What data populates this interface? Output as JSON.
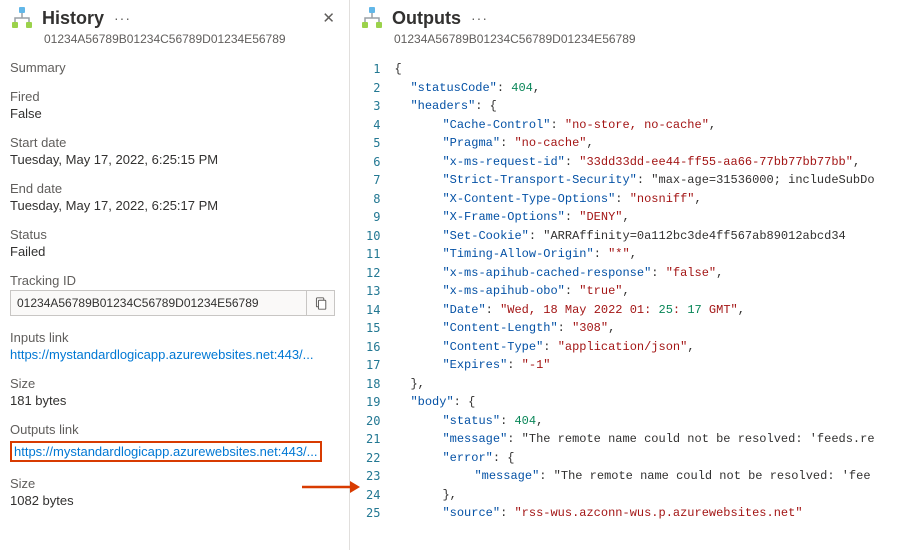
{
  "history": {
    "title": "History",
    "sub": "01234A56789B01234C56789D01234E56789",
    "summary_label": "Summary",
    "fired_label": "Fired",
    "fired_value": "False",
    "start_label": "Start date",
    "start_value": "Tuesday, May 17, 2022, 6:25:15 PM",
    "end_label": "End date",
    "end_value": "Tuesday, May 17, 2022, 6:25:17 PM",
    "status_label": "Status",
    "status_value": "Failed",
    "tracking_label": "Tracking ID",
    "tracking_value": "01234A56789B01234C56789D01234E56789",
    "inputs_link_label": "Inputs link",
    "inputs_link": "https://mystandardlogicapp.azurewebsites.net:443/...",
    "inputs_size_label": "Size",
    "inputs_size_value": "181 bytes",
    "outputs_link_label": "Outputs link",
    "outputs_link": "https://mystandardlogicapp.azurewebsites.net:443/...",
    "outputs_size_label": "Size",
    "outputs_size_value": "1082 bytes"
  },
  "outputs": {
    "title": "Outputs",
    "sub": "01234A56789B01234C56789D01234E56789"
  },
  "chart_data": {
    "type": "table",
    "note": "JSON response payload shown in Outputs code pane",
    "statusCode": 404,
    "headers": {
      "Cache-Control": "no-store, no-cache",
      "Pragma": "no-cache",
      "x-ms-request-id": "33dd33dd-ee44-ff55-aa66-77bb77bb77bb",
      "Strict-Transport-Security": "max-age=31536000; includeSubDo",
      "X-Content-Type-Options": "nosniff",
      "X-Frame-Options": "DENY",
      "Set-Cookie": "ARRAffinity=0a112bc3de4ff567ab89012abcd34",
      "Timing-Allow-Origin": "*",
      "x-ms-apihub-cached-response": "false",
      "x-ms-apihub-obo": "true",
      "Date": "Wed, 18 May 2022 01:25:17 GMT",
      "Content-Length": "308",
      "Content-Type": "application/json",
      "Expires": "-1"
    },
    "body": {
      "status": 404,
      "message": "The remote name could not be resolved: 'feeds.re",
      "error": {
        "message": "The remote name could not be resolved: 'fee"
      },
      "source": "rss-wus.azconn-wus.p.azurewebsites.net"
    }
  },
  "code_lines": [
    "{",
    "  \"statusCode\": 404,",
    "  \"headers\": {",
    "    \"Cache-Control\": \"no-store, no-cache\",",
    "    \"Pragma\": \"no-cache\",",
    "    \"x-ms-request-id\": \"33dd33dd-ee44-ff55-aa66-77bb77bb77bb\",",
    "    \"Strict-Transport-Security\": \"max-age=31536000; includeSubDo",
    "    \"X-Content-Type-Options\": \"nosniff\",",
    "    \"X-Frame-Options\": \"DENY\",",
    "    \"Set-Cookie\": \"ARRAffinity=0a112bc3de4ff567ab89012abcd34",
    "    \"Timing-Allow-Origin\": \"*\",",
    "    \"x-ms-apihub-cached-response\": \"false\",",
    "    \"x-ms-apihub-obo\": \"true\",",
    "    \"Date\": \"Wed, 18 May 2022 01:25:17 GMT\",",
    "    \"Content-Length\": \"308\",",
    "    \"Content-Type\": \"application/json\",",
    "    \"Expires\": \"-1\"",
    "  },",
    "  \"body\": {",
    "    \"status\": 404,",
    "    \"message\": \"The remote name could not be resolved: 'feeds.re",
    "    \"error\": {",
    "      \"message\": \"The remote name could not be resolved: 'fee",
    "    },",
    "    \"source\": \"rss-wus.azconn-wus.p.azurewebsites.net\""
  ]
}
